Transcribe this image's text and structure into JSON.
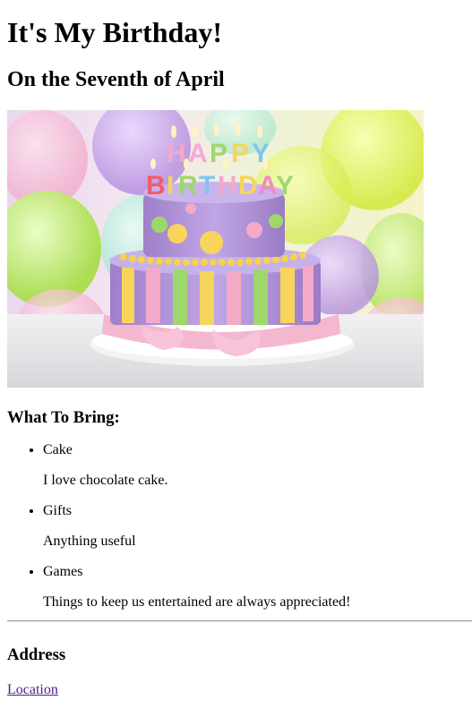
{
  "page": {
    "title": "It's My Birthday!",
    "subtitle": "On the Seventh of April"
  },
  "hero_image": {
    "icon": "birthday-cake-photo",
    "text": "HAPPY BIRTHDAY"
  },
  "bring": {
    "heading": "What To Bring:",
    "items": [
      {
        "label": "Cake",
        "description": "I love chocolate cake."
      },
      {
        "label": "Gifts",
        "description": "Anything useful"
      },
      {
        "label": "Games",
        "description": "Things to keep us entertained are always appreciated!"
      }
    ]
  },
  "address": {
    "heading": "Address",
    "link_label": "Location"
  },
  "colors": {
    "link_visited": "#551a8b",
    "divider": "#9a9a9a"
  }
}
